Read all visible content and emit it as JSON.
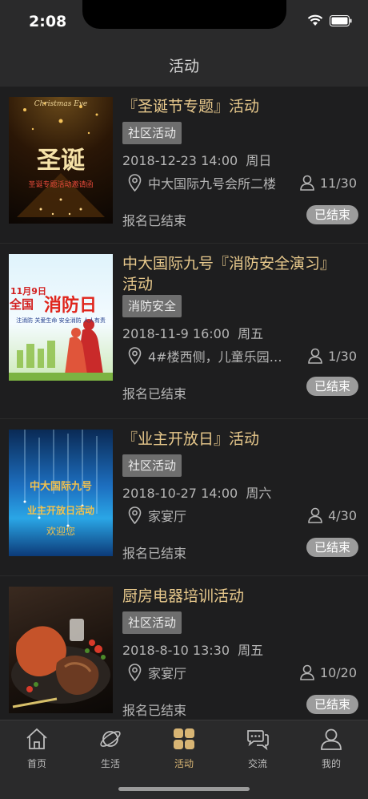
{
  "status": {
    "time": "2:08"
  },
  "nav": {
    "title": "活动"
  },
  "activities": [
    {
      "title": "『圣诞节专题』活动",
      "tag": "社区活动",
      "date": "2018-12-23 14:00  周日",
      "location": "中大国际九号会所二楼",
      "people": "11/30",
      "reg_status": "报名已结束",
      "badge": "已结束",
      "thumb_text": [
        "Christmas Eve",
        "圣诞",
        "圣诞专题活动邀请函"
      ]
    },
    {
      "title": "中大国际九号『消防安全演习』活动",
      "tag": "消防安全",
      "date": "2018-11-9 16:00  周五",
      "location": "4#楼西侧，儿童乐园…",
      "people": "1/30",
      "reg_status": "报名已结束",
      "badge": "已结束",
      "thumb_text": [
        "11月9日",
        "全国",
        "消防日",
        "注消防 关爱生命 安全消防 人人有责"
      ]
    },
    {
      "title": "『业主开放日』活动",
      "tag": "社区活动",
      "date": "2018-10-27 14:00  周六",
      "location": "家宴厅",
      "people": "4/30",
      "reg_status": "报名已结束",
      "badge": "已结束",
      "thumb_text": [
        "中大国际九号",
        "业主开放日活动",
        "欢迎您"
      ]
    },
    {
      "title": "厨房电器培训活动",
      "tag": "社区活动",
      "date": "2018-8-10 13:30  周五",
      "location": "家宴厅",
      "people": "10/20",
      "reg_status": "报名已结束",
      "badge": "已结束"
    }
  ],
  "tabs": [
    {
      "label": "首页",
      "icon": "home-icon"
    },
    {
      "label": "生活",
      "icon": "planet-icon"
    },
    {
      "label": "活动",
      "icon": "grid-icon",
      "active": true
    },
    {
      "label": "交流",
      "icon": "chat-icon"
    },
    {
      "label": "我的",
      "icon": "user-icon"
    }
  ],
  "colors": {
    "accent": "#d8b574",
    "title": "#e8c98c",
    "tag_bg": "#6e6e6e",
    "badge_bg": "#9c9c9c",
    "background": "#1e1e1f",
    "bar": "#2a2a2b"
  }
}
